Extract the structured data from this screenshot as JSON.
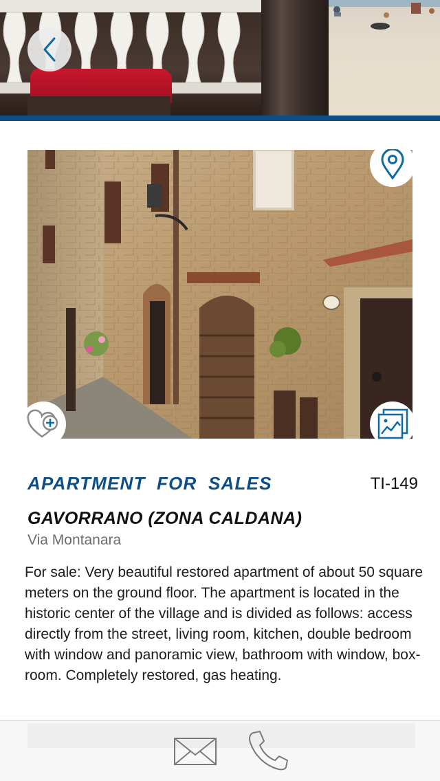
{
  "header": {
    "back_icon": "chevron-left-icon"
  },
  "property": {
    "photo_description": "stone building facade",
    "actions": {
      "map_icon": "map-pin-icon",
      "favorite_icon": "heart-plus-icon",
      "gallery_icon": "image-gallery-icon"
    },
    "type_label": "APARTMENT  FOR  SALES",
    "reference": "TI-149",
    "location": "GAVORRANO (ZONA CALDANA)",
    "address": "Via Montanara",
    "description": "For sale: Very beautiful restored apartment of about 50 square meters on the ground floor. The apartment is located in the historic center of the village and is divided as follows: access directly from the street, living room, kitchen, double bedroom with window and panoramic view, bathroom with window, box-room. Completely restored, gas heating."
  },
  "bottom_bar": {
    "mail_icon": "envelope-icon",
    "phone_icon": "phone-icon"
  },
  "colors": {
    "accent": "#0e4e86",
    "text": "#1c1c1c",
    "muted": "#6c6c6c"
  }
}
